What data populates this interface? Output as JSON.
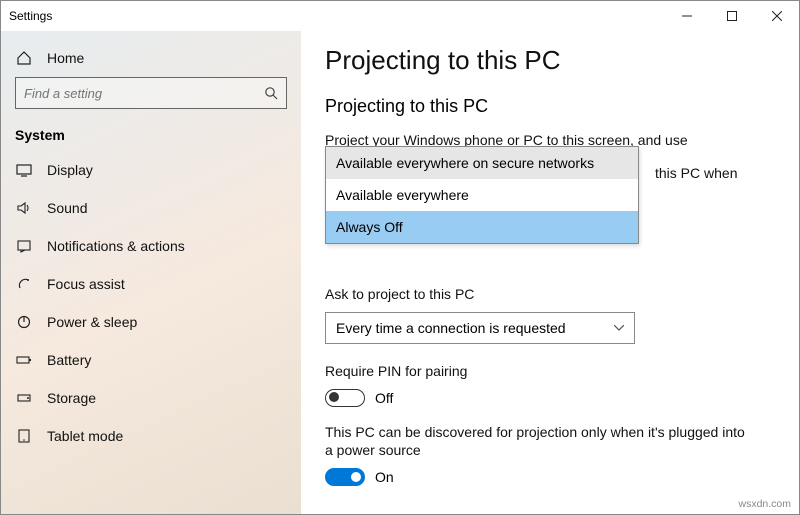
{
  "window": {
    "title": "Settings"
  },
  "sidebar": {
    "home": "Home",
    "search_placeholder": "Find a setting",
    "category": "System",
    "items": [
      {
        "label": "Display"
      },
      {
        "label": "Sound"
      },
      {
        "label": "Notifications & actions"
      },
      {
        "label": "Focus assist"
      },
      {
        "label": "Power & sleep"
      },
      {
        "label": "Battery"
      },
      {
        "label": "Storage"
      },
      {
        "label": "Tablet mode"
      }
    ]
  },
  "page": {
    "title": "Projecting to this PC",
    "section": "Projecting to this PC",
    "intro": "Project your Windows phone or PC to this screen, and use its keyboard, mouse, and other devices, too.",
    "hidden_right_text": "this PC when",
    "dropdown1": {
      "options": [
        "Available everywhere on secure networks",
        "Available everywhere",
        "Always Off"
      ],
      "hover_index": 0,
      "selected_index": 2
    },
    "ask_label": "Ask to project to this PC",
    "ask_value": "Every time a connection is requested",
    "pin_label": "Require PIN for pairing",
    "pin_state": "Off",
    "discover_label": "This PC can be discovered for projection only when it's plugged into a power source",
    "discover_state": "On"
  },
  "watermark": "wsxdn.com"
}
